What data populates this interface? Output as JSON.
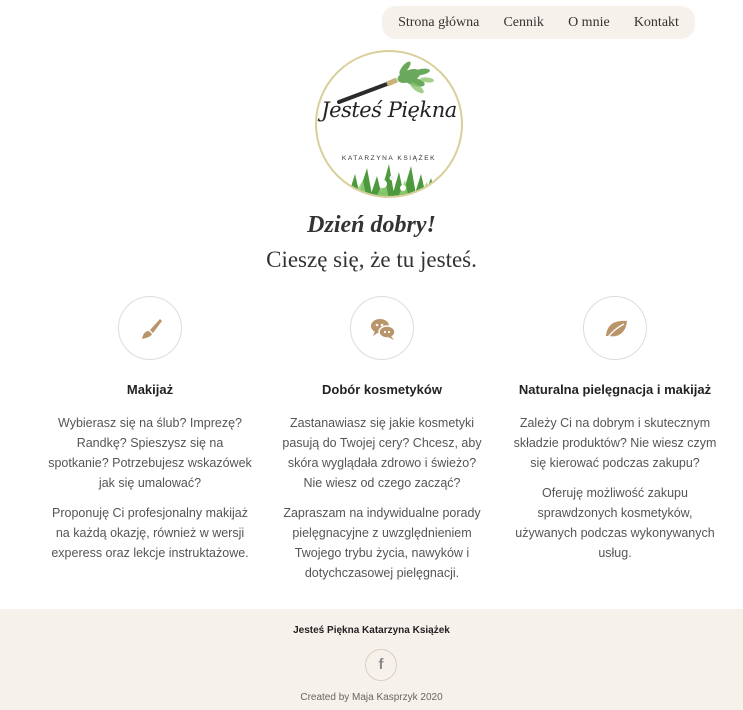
{
  "nav": {
    "items": [
      {
        "label": "Strona główna"
      },
      {
        "label": "Cennik"
      },
      {
        "label": "O mnie"
      },
      {
        "label": "Kontakt"
      }
    ]
  },
  "logo": {
    "script_text": "Jesteś Piękna",
    "subtitle": "KATARZYNA KSIĄŻEK"
  },
  "hero": {
    "greeting": "Dzień dobry!",
    "tagline": "Cieszę się, że tu jesteś."
  },
  "services": [
    {
      "icon": "brush-icon",
      "title": "Makijaż",
      "paragraphs": [
        "Wybierasz się na ślub? Imprezę? Randkę? Spieszysz się na spotkanie? Potrzebujesz wskazówek jak się umalować?",
        "Proponuję Ci profesjonalny makijaż na każdą okazję, również w wersji experess oraz lekcje instruktażowe."
      ]
    },
    {
      "icon": "chat-bubbles-icon",
      "title": "Dobór kosmetyków",
      "paragraphs": [
        "Zastanawiasz się jakie kosmetyki pasują do Twojej cery? Chcesz, aby skóra wyglądała zdrowo i świeżo? Nie wiesz od czego zacząć?",
        "Zapraszam na indywidualne porady pielęgnacyjne z uwzględnieniem Twojego trybu życia, nawyków i dotychczasowej pielęgnacji."
      ]
    },
    {
      "icon": "leaf-icon",
      "title": "Naturalna pielęgnacja i makijaż",
      "paragraphs": [
        "Zależy Ci na dobrym i skutecznym składzie produktów? Nie wiesz czym się kierować podczas zakupu?",
        "Oferuję możliwość zakupu sprawdzonych kosmetyków, używanych podczas wykonywanych usług."
      ]
    }
  ],
  "footer": {
    "title": "Jesteś Piękna Katarzyna Książek",
    "facebook_glyph": "f",
    "credit": "Created by Maja Kasprzyk 2020"
  },
  "colors": {
    "accent": "#b8956a",
    "beige_bg": "#f6f1ea",
    "logo_ring": "#d9cf9a",
    "leaf_green": "#5aa04a"
  }
}
